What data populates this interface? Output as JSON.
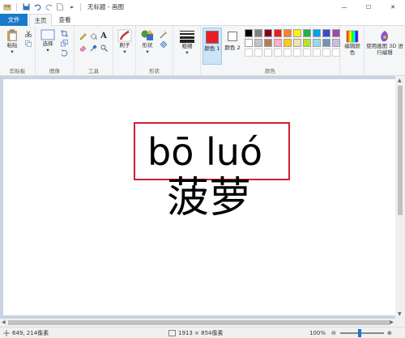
{
  "window": {
    "title": "无标题 - 画图",
    "controls": {
      "minimize": "—",
      "maximize": "☐",
      "close": "✕"
    }
  },
  "menu": {
    "file": "文件",
    "home": "主页",
    "view": "查看"
  },
  "ribbon": {
    "clipboard": {
      "paste": "粘贴",
      "group": "剪贴板"
    },
    "image": {
      "select": "选择",
      "group": "图像"
    },
    "tools": {
      "text_icon": "A",
      "group": "工具"
    },
    "brushes": {
      "label": "刷子"
    },
    "shapes": {
      "label": "形状",
      "group": "形状"
    },
    "size": {
      "label": "粗细"
    },
    "color1": {
      "label": "颜色 1",
      "value": "#ed1c24"
    },
    "color2": {
      "label": "颜色 2",
      "value": "#ffffff"
    },
    "colors_group": "颜色",
    "edit_colors": "编辑颜色",
    "paint3d": "使用画图 3D 进行编辑",
    "palette_row1": [
      "#000000",
      "#7f7f7f",
      "#880015",
      "#ed1c24",
      "#ff7f27",
      "#fff200",
      "#22b14c",
      "#00a2e8",
      "#3f48cc",
      "#a349a4"
    ],
    "palette_row2": [
      "#ffffff",
      "#c3c3c3",
      "#b97a57",
      "#ffaec9",
      "#ffc90e",
      "#efe4b0",
      "#b5e61d",
      "#99d9ea",
      "#7092be",
      "#c8bfe7"
    ]
  },
  "canvas": {
    "pinyin": "bō luó",
    "hanzi": "菠萝",
    "box_color": "#d0212e"
  },
  "status": {
    "cursor_pos": "649, 214像素",
    "canvas_size": "1913 × 854像素",
    "zoom": "100%",
    "zoom_fraction": 0.45
  }
}
